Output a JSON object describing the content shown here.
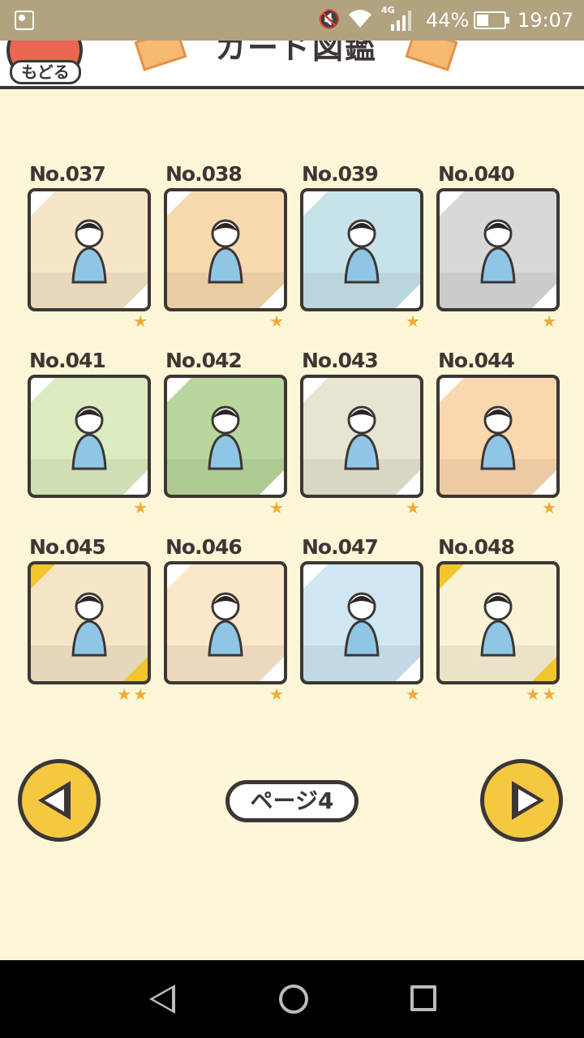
{
  "status_bar": {
    "network": "4G",
    "battery": "44%",
    "time": "19:07"
  },
  "header": {
    "back_label": "もどる",
    "title": "カード図鑑"
  },
  "cards": [
    {
      "number": "No.037",
      "stars": "★",
      "bg": "#f6e6c8",
      "corner": "#fff",
      "rarity": 1
    },
    {
      "number": "No.038",
      "stars": "★",
      "bg": "#f8d9ae",
      "corner": "#fff",
      "rarity": 1
    },
    {
      "number": "No.039",
      "stars": "★",
      "bg": "#c7e3ea",
      "corner": "#fff",
      "rarity": 1
    },
    {
      "number": "No.040",
      "stars": "★",
      "bg": "#d8d8d8",
      "corner": "#fff",
      "rarity": 1
    },
    {
      "number": "No.041",
      "stars": "★",
      "bg": "#dcecc0",
      "corner": "#fff",
      "rarity": 1
    },
    {
      "number": "No.042",
      "stars": "★",
      "bg": "#b9d79c",
      "corner": "#fff",
      "rarity": 1
    },
    {
      "number": "No.043",
      "stars": "★",
      "bg": "#e8e4d2",
      "corner": "#fff",
      "rarity": 1
    },
    {
      "number": "No.044",
      "stars": "★",
      "bg": "#fbd7ae",
      "corner": "#fff",
      "rarity": 1
    },
    {
      "number": "No.045",
      "stars": "★★",
      "bg": "#f4e6c6",
      "corner": "#f2c52c",
      "rarity": 2
    },
    {
      "number": "No.046",
      "stars": "★",
      "bg": "#fbe7c9",
      "corner": "#fff",
      "rarity": 1
    },
    {
      "number": "No.047",
      "stars": "★",
      "bg": "#cfe6f3",
      "corner": "#fff",
      "rarity": 1
    },
    {
      "number": "No.048",
      "stars": "★★",
      "bg": "#faf2d4",
      "corner": "#f2c52c",
      "rarity": 2
    }
  ],
  "pagination": {
    "page_label": "ページ4"
  },
  "colors": {
    "background": "#fbf7d6",
    "outline": "#3c3635",
    "accent_yellow": "#f5c842",
    "star": "#f2a93a",
    "back_red": "#ea6650"
  }
}
